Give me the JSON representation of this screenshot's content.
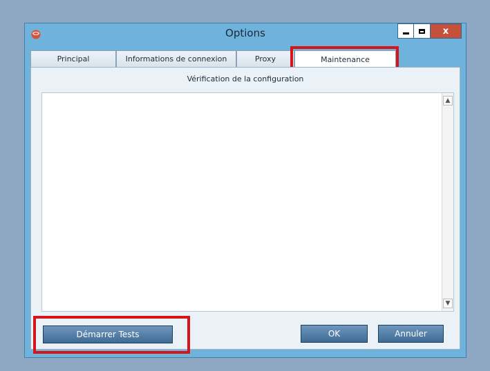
{
  "window": {
    "title": "Options",
    "app_icon": "app-logo-icon",
    "controls": {
      "minimize_icon": "minimize-icon",
      "maximize_icon": "maximize-icon",
      "close_label": "x"
    }
  },
  "tabs": [
    {
      "label": "Principal",
      "active": false
    },
    {
      "label": "Informations de connexion",
      "active": false
    },
    {
      "label": "Proxy",
      "active": false
    },
    {
      "label": "Maintenance",
      "active": true
    }
  ],
  "panel": {
    "heading": "Vérification de la configuration",
    "log_text": ""
  },
  "buttons": {
    "start_tests": "Démarrer Tests",
    "ok": "OK",
    "cancel": "Annuler"
  },
  "colors": {
    "window_frame": "#6fb3dd",
    "highlight": "#d4151c",
    "button_fill": "#3e6b95",
    "close_button": "#c7503a"
  }
}
